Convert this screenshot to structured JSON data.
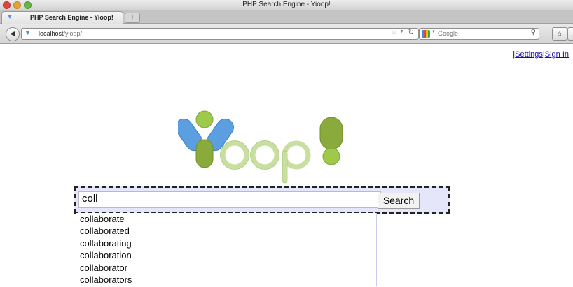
{
  "window": {
    "title": "PHP Search Engine - Yioop!"
  },
  "tabs": [
    {
      "label": "PHP Search Engine - Yioop!",
      "active": true
    }
  ],
  "newtab_label": "+",
  "navbar": {
    "url_host": "localhost",
    "url_path": "/yioop/",
    "search_placeholder": "Google",
    "icons": [
      "back-arrow-icon",
      "favicon-icon",
      "star-icon",
      "dropdown-icon",
      "reload-icon",
      "google-icon",
      "magnifier-icon",
      "home-icon"
    ]
  },
  "page": {
    "links": [
      "Settings",
      "Sign In"
    ],
    "logo_text": "Yioop!",
    "search": {
      "query": "coll",
      "button_label": "Search"
    },
    "suggestions": [
      "collaborate",
      "collaborated",
      "collaborating",
      "collaboration",
      "collaborator",
      "collaborators"
    ]
  },
  "colors": {
    "form_background": "#e6e6fa",
    "logo_blue": "#5b9fe0",
    "logo_green": "#8aab3c",
    "logo_light_green": "#c8dfa0",
    "link": "#1a0dab"
  }
}
